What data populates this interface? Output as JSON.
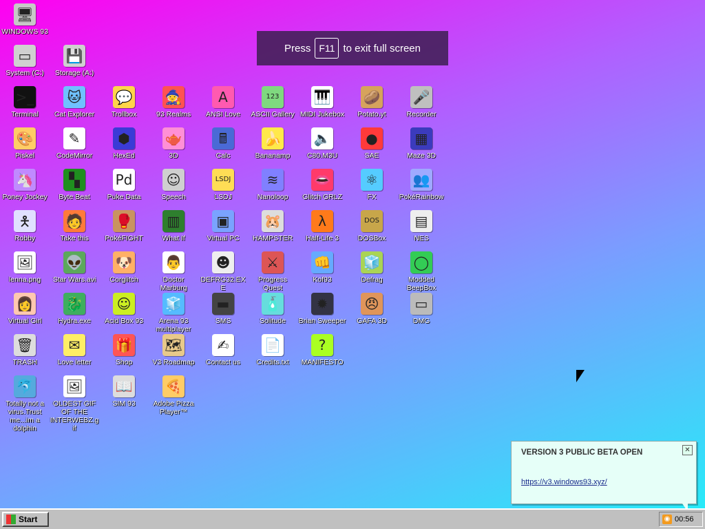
{
  "desktop": {
    "icons": [
      {
        "label": "WINDOWS 93",
        "glyph": "🖥",
        "color": "#c8c8c8"
      },
      {
        "label": "System (C:)",
        "glyph": "▭",
        "color": "#d0d0d0"
      },
      {
        "label": "Storage (A:)",
        "glyph": "💾",
        "color": "#d0d0d0"
      },
      {
        "label": "Terminal",
        "glyph": ">_",
        "color": "#111111"
      },
      {
        "label": "Cat Explorer",
        "glyph": "🐱",
        "color": "#6fc1ff"
      },
      {
        "label": "Trollbox",
        "glyph": "💬",
        "color": "#ffd54a"
      },
      {
        "label": "93 Realms",
        "glyph": "🧙",
        "color": "#ff5252"
      },
      {
        "label": "ANSI Love",
        "glyph": "A",
        "color": "#ff5ab0"
      },
      {
        "label": "ASCII Gallery",
        "glyph": "123",
        "color": "#7fd97f"
      },
      {
        "label": "MIDI Jukebox",
        "glyph": "🎹",
        "color": "#ffffff"
      },
      {
        "label": "Potato.yt",
        "glyph": "🥔",
        "color": "#d6a35c"
      },
      {
        "label": "Recorder",
        "glyph": "🎤",
        "color": "#bfbfbf"
      },
      {
        "label": "Piskel",
        "glyph": "🎨",
        "color": "#ffcc66"
      },
      {
        "label": "CodeMirror",
        "glyph": "✎",
        "color": "#ffffff"
      },
      {
        "label": "HexEd",
        "glyph": "⬢",
        "color": "#3b3bd6"
      },
      {
        "label": "3D",
        "glyph": "🫖",
        "color": "#ff8fd6"
      },
      {
        "label": "Calc",
        "glyph": "🖩",
        "color": "#4a6ad6"
      },
      {
        "label": "Bananamp",
        "glyph": "🍌",
        "color": "#ffe94a"
      },
      {
        "label": "C80.M3U",
        "glyph": "🔈",
        "color": "#ffffff"
      },
      {
        "label": "SAE",
        "glyph": "●",
        "color": "#ff3a3a"
      },
      {
        "label": "Maze 3D",
        "glyph": "▦",
        "color": "#3b3bbd"
      },
      {
        "label": "Poney Jockey",
        "glyph": "🦄",
        "color": "#c08aff"
      },
      {
        "label": "Byte Beat",
        "glyph": "▚",
        "color": "#1f8f1f"
      },
      {
        "label": "Puke Data",
        "glyph": "Pd",
        "color": "#ffffff"
      },
      {
        "label": "Speech",
        "glyph": "☺",
        "color": "#cfcfcf"
      },
      {
        "label": "LSDJ",
        "glyph": "LSDJ",
        "color": "#ffdd55"
      },
      {
        "label": "Nanoloop",
        "glyph": "≋",
        "color": "#8080ff"
      },
      {
        "label": "Glitch GRLZ",
        "glyph": "👄",
        "color": "#ff3a6a"
      },
      {
        "label": "FX",
        "glyph": "⚛",
        "color": "#55ccff"
      },
      {
        "label": "PokéRainbow",
        "glyph": "👥",
        "color": "#9fa9ff"
      },
      {
        "label": "Robby",
        "glyph": "🯅",
        "color": "#e0e0ff"
      },
      {
        "label": "Take this",
        "glyph": "🧑",
        "color": "#ff7a3a"
      },
      {
        "label": "PokéFIGHT",
        "glyph": "🥊",
        "color": "#c99360"
      },
      {
        "label": "What If",
        "glyph": "▥",
        "color": "#2e7f2e"
      },
      {
        "label": "Virtual PC",
        "glyph": "▣",
        "color": "#7aa3ff"
      },
      {
        "label": "HAMPSTER",
        "glyph": "🐹",
        "color": "#dddddd"
      },
      {
        "label": "Half-Life 3",
        "glyph": "λ",
        "color": "#ff7a1a"
      },
      {
        "label": "DOSBox",
        "glyph": "DOS",
        "color": "#c8a64a"
      },
      {
        "label": "NES",
        "glyph": "▤",
        "color": "#eeeeee"
      },
      {
        "label": "lenna.png",
        "glyph": "🖼",
        "color": "#ffffff"
      },
      {
        "label": "Star Wars.avi",
        "glyph": "👽",
        "color": "#5ca85c"
      },
      {
        "label": "Corglitch",
        "glyph": "🐶",
        "color": "#ffb066"
      },
      {
        "label": "Doctor Marburg",
        "glyph": "👨",
        "color": "#ffffff"
      },
      {
        "label": "DEFRG32.EXE",
        "glyph": "☻",
        "color": "#eeeeee"
      },
      {
        "label": "Progress Quest",
        "glyph": "⚔",
        "color": "#dd5555"
      },
      {
        "label": "Kof93",
        "glyph": "👊",
        "color": "#66aaff"
      },
      {
        "label": "Defrag",
        "glyph": "🧊",
        "color": "#aad455"
      },
      {
        "label": "Modded BeepBox",
        "glyph": "◯",
        "color": "#33cc55"
      },
      {
        "label": "Virtual Girl",
        "glyph": "👩",
        "color": "#ffc8b0"
      },
      {
        "label": "Hydra.exe",
        "glyph": "🐉",
        "color": "#3fae5f"
      },
      {
        "label": "Acid Box 93",
        "glyph": "☺",
        "color": "#ccee22"
      },
      {
        "label": "Arena 93 multiplayer",
        "glyph": "🧊",
        "color": "#55bbff"
      },
      {
        "label": "SMS",
        "glyph": "▬",
        "color": "#444444"
      },
      {
        "label": "Solitude",
        "glyph": "🧴",
        "color": "#66dddd"
      },
      {
        "label": "Brian Sweeper",
        "glyph": "✹",
        "color": "#333344"
      },
      {
        "label": "GAFA 3D",
        "glyph": "😠",
        "color": "#e0955a"
      },
      {
        "label": "DMG",
        "glyph": "▭",
        "color": "#bbbbbb"
      },
      {
        "label": "TRASH",
        "glyph": "🗑",
        "color": "#dddddd"
      },
      {
        "label": "Love letter",
        "glyph": "✉",
        "color": "#ffee66"
      },
      {
        "label": "Shop",
        "glyph": "🎁",
        "color": "#ff5555"
      },
      {
        "label": "V3 Roadmap",
        "glyph": "🗺",
        "color": "#e8c98a"
      },
      {
        "label": "Contact us",
        "glyph": "✍",
        "color": "#ffffff"
      },
      {
        "label": "Credits.txt",
        "glyph": "📄",
        "color": "#ffffff"
      },
      {
        "label": "MANIFESTO",
        "glyph": "?",
        "color": "#aaff22"
      },
      {
        "label": "Totally not a virus.Trust me...im a dolphin",
        "glyph": "🐬",
        "color": "#55aadd"
      },
      {
        "label": "OLDEST GIF OF THE INTERWEBZ.gif",
        "glyph": "🖼",
        "color": "#ffffff"
      },
      {
        "label": "SIM 93",
        "glyph": "📖",
        "color": "#dddddd"
      },
      {
        "label": "Adobe Pizza Player™",
        "glyph": "🍕",
        "color": "#ffcc66"
      }
    ]
  },
  "fullscreen_banner": {
    "before": "Press",
    "key": "F11",
    "after": "to exit full screen"
  },
  "notification": {
    "title": "VERSION 3 PUBLIC BETA OPEN",
    "link": "https://v3.windows93.xyz/",
    "close_glyph": "✕"
  },
  "taskbar": {
    "start_label": "Start",
    "clock": "00:56",
    "tray_icon": "rss-icon"
  }
}
